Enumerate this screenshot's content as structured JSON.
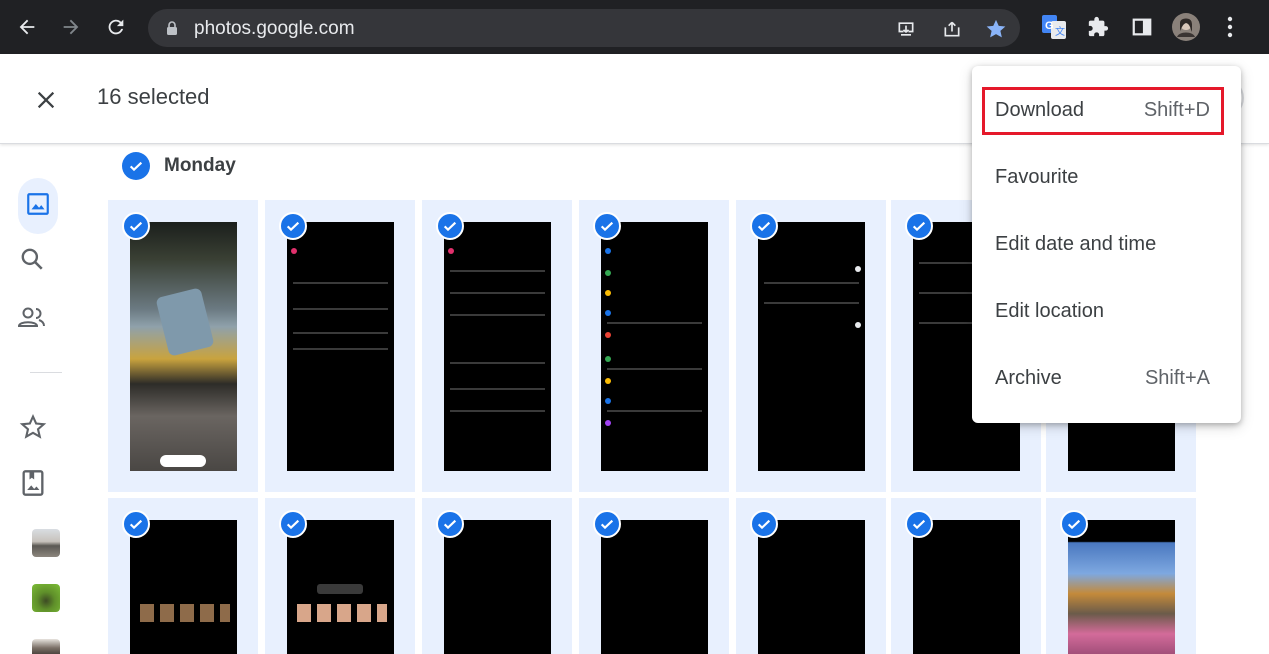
{
  "browser": {
    "url": "photos.google.com",
    "icons": [
      "back-arrow-icon",
      "forward-arrow-icon",
      "reload-icon",
      "lock-icon",
      "install-icon",
      "share-icon",
      "star-icon",
      "google-translate-icon",
      "extensions-icon",
      "side-panel-icon",
      "profile-avatar",
      "more-vert-icon"
    ]
  },
  "header": {
    "selection_label": "16 selected",
    "close_icon": "close-icon"
  },
  "sidebar": {
    "items": [
      "photos-icon",
      "search-icon",
      "people-icon",
      "star-icon",
      "photo-album-icon"
    ]
  },
  "section": {
    "day_label": "Monday"
  },
  "menu": {
    "items": [
      {
        "label": "Download",
        "shortcut": "Shift+D"
      },
      {
        "label": "Favourite",
        "shortcut": ""
      },
      {
        "label": "Edit date and time",
        "shortcut": ""
      },
      {
        "label": "Edit location",
        "shortcut": ""
      },
      {
        "label": "Archive",
        "shortcut": "Shift+A"
      }
    ]
  },
  "colors": {
    "accent": "#1a73e8",
    "selected_tile_bg": "#e8f0fe",
    "highlight_border": "#e5182a",
    "chrome_bg": "#202124"
  }
}
